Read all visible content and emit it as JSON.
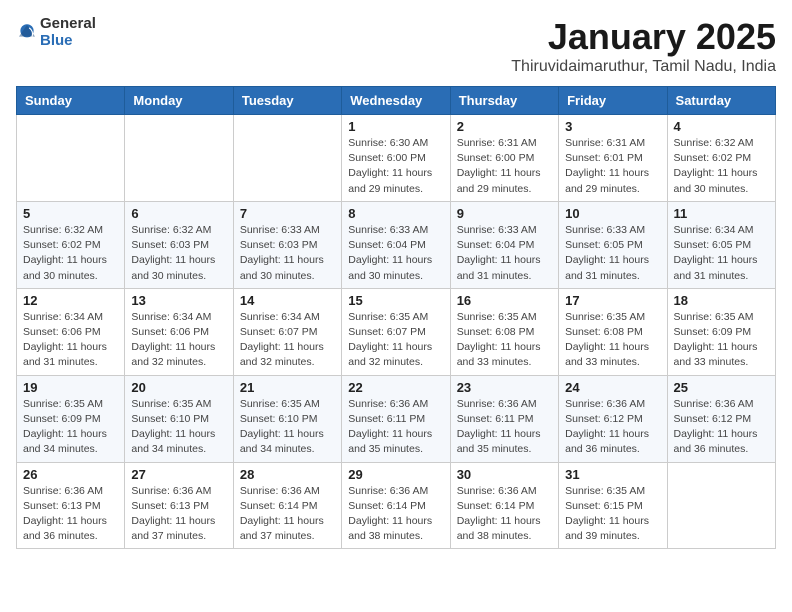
{
  "header": {
    "logo_general": "General",
    "logo_blue": "Blue",
    "title": "January 2025",
    "subtitle": "Thiruvidaimaruthur, Tamil Nadu, India"
  },
  "days_of_week": [
    "Sunday",
    "Monday",
    "Tuesday",
    "Wednesday",
    "Thursday",
    "Friday",
    "Saturday"
  ],
  "weeks": [
    [
      {
        "day": "",
        "info": ""
      },
      {
        "day": "",
        "info": ""
      },
      {
        "day": "",
        "info": ""
      },
      {
        "day": "1",
        "info": "Sunrise: 6:30 AM\nSunset: 6:00 PM\nDaylight: 11 hours\nand 29 minutes."
      },
      {
        "day": "2",
        "info": "Sunrise: 6:31 AM\nSunset: 6:00 PM\nDaylight: 11 hours\nand 29 minutes."
      },
      {
        "day": "3",
        "info": "Sunrise: 6:31 AM\nSunset: 6:01 PM\nDaylight: 11 hours\nand 29 minutes."
      },
      {
        "day": "4",
        "info": "Sunrise: 6:32 AM\nSunset: 6:02 PM\nDaylight: 11 hours\nand 30 minutes."
      }
    ],
    [
      {
        "day": "5",
        "info": "Sunrise: 6:32 AM\nSunset: 6:02 PM\nDaylight: 11 hours\nand 30 minutes."
      },
      {
        "day": "6",
        "info": "Sunrise: 6:32 AM\nSunset: 6:03 PM\nDaylight: 11 hours\nand 30 minutes."
      },
      {
        "day": "7",
        "info": "Sunrise: 6:33 AM\nSunset: 6:03 PM\nDaylight: 11 hours\nand 30 minutes."
      },
      {
        "day": "8",
        "info": "Sunrise: 6:33 AM\nSunset: 6:04 PM\nDaylight: 11 hours\nand 30 minutes."
      },
      {
        "day": "9",
        "info": "Sunrise: 6:33 AM\nSunset: 6:04 PM\nDaylight: 11 hours\nand 31 minutes."
      },
      {
        "day": "10",
        "info": "Sunrise: 6:33 AM\nSunset: 6:05 PM\nDaylight: 11 hours\nand 31 minutes."
      },
      {
        "day": "11",
        "info": "Sunrise: 6:34 AM\nSunset: 6:05 PM\nDaylight: 11 hours\nand 31 minutes."
      }
    ],
    [
      {
        "day": "12",
        "info": "Sunrise: 6:34 AM\nSunset: 6:06 PM\nDaylight: 11 hours\nand 31 minutes."
      },
      {
        "day": "13",
        "info": "Sunrise: 6:34 AM\nSunset: 6:06 PM\nDaylight: 11 hours\nand 32 minutes."
      },
      {
        "day": "14",
        "info": "Sunrise: 6:34 AM\nSunset: 6:07 PM\nDaylight: 11 hours\nand 32 minutes."
      },
      {
        "day": "15",
        "info": "Sunrise: 6:35 AM\nSunset: 6:07 PM\nDaylight: 11 hours\nand 32 minutes."
      },
      {
        "day": "16",
        "info": "Sunrise: 6:35 AM\nSunset: 6:08 PM\nDaylight: 11 hours\nand 33 minutes."
      },
      {
        "day": "17",
        "info": "Sunrise: 6:35 AM\nSunset: 6:08 PM\nDaylight: 11 hours\nand 33 minutes."
      },
      {
        "day": "18",
        "info": "Sunrise: 6:35 AM\nSunset: 6:09 PM\nDaylight: 11 hours\nand 33 minutes."
      }
    ],
    [
      {
        "day": "19",
        "info": "Sunrise: 6:35 AM\nSunset: 6:09 PM\nDaylight: 11 hours\nand 34 minutes."
      },
      {
        "day": "20",
        "info": "Sunrise: 6:35 AM\nSunset: 6:10 PM\nDaylight: 11 hours\nand 34 minutes."
      },
      {
        "day": "21",
        "info": "Sunrise: 6:35 AM\nSunset: 6:10 PM\nDaylight: 11 hours\nand 34 minutes."
      },
      {
        "day": "22",
        "info": "Sunrise: 6:36 AM\nSunset: 6:11 PM\nDaylight: 11 hours\nand 35 minutes."
      },
      {
        "day": "23",
        "info": "Sunrise: 6:36 AM\nSunset: 6:11 PM\nDaylight: 11 hours\nand 35 minutes."
      },
      {
        "day": "24",
        "info": "Sunrise: 6:36 AM\nSunset: 6:12 PM\nDaylight: 11 hours\nand 36 minutes."
      },
      {
        "day": "25",
        "info": "Sunrise: 6:36 AM\nSunset: 6:12 PM\nDaylight: 11 hours\nand 36 minutes."
      }
    ],
    [
      {
        "day": "26",
        "info": "Sunrise: 6:36 AM\nSunset: 6:13 PM\nDaylight: 11 hours\nand 36 minutes."
      },
      {
        "day": "27",
        "info": "Sunrise: 6:36 AM\nSunset: 6:13 PM\nDaylight: 11 hours\nand 37 minutes."
      },
      {
        "day": "28",
        "info": "Sunrise: 6:36 AM\nSunset: 6:14 PM\nDaylight: 11 hours\nand 37 minutes."
      },
      {
        "day": "29",
        "info": "Sunrise: 6:36 AM\nSunset: 6:14 PM\nDaylight: 11 hours\nand 38 minutes."
      },
      {
        "day": "30",
        "info": "Sunrise: 6:36 AM\nSunset: 6:14 PM\nDaylight: 11 hours\nand 38 minutes."
      },
      {
        "day": "31",
        "info": "Sunrise: 6:35 AM\nSunset: 6:15 PM\nDaylight: 11 hours\nand 39 minutes."
      },
      {
        "day": "",
        "info": ""
      }
    ]
  ]
}
